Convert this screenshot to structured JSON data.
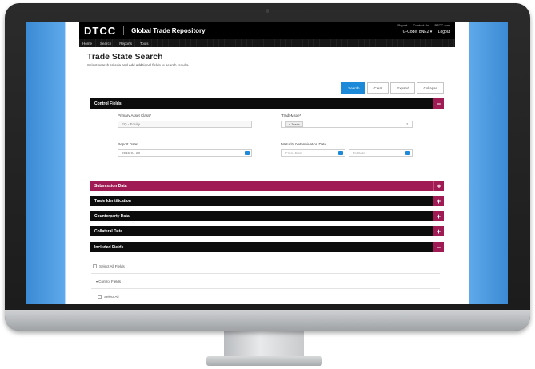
{
  "app": {
    "logo": "DTCC",
    "title": "Global Trade Repository",
    "top_links": [
      "Report",
      "Contact Us",
      "BTCC.com"
    ],
    "user_code": "G-Code: 8NE2 ▾",
    "logout": "Logout"
  },
  "nav": [
    "Home",
    "Search",
    "Reports",
    "Tools"
  ],
  "page": {
    "title": "Trade State Search",
    "subtitle": "Select search criteria and add additional fields to search results."
  },
  "buttons": {
    "search": "Search",
    "clear": "Clear",
    "expand": "Expand",
    "collapse": "Collapse"
  },
  "control_fields": {
    "header": "Control Fields",
    "toggle": "−",
    "primary_asset_label": "Primary Asset Class*",
    "primary_asset_value": "EQ - Equity",
    "trade_msg_label": "TradeMsge*",
    "trade_msg_value": "× Trade",
    "report_date_label": "Report Date*",
    "report_date_value": "2015-04-28",
    "maturity_label": "Maturity Determination Date",
    "maturity_from_placeholder": "From Date",
    "maturity_to_placeholder": "To Date"
  },
  "sections": [
    {
      "label": "Submission Data",
      "toggle": "+"
    },
    {
      "label": "Trade Identification",
      "toggle": "+"
    },
    {
      "label": "Counterparty Data",
      "toggle": "+"
    },
    {
      "label": "Collateral Data",
      "toggle": "+"
    },
    {
      "label": "Included Fields",
      "toggle": "−"
    }
  ],
  "included": {
    "select_all_fields": "Select All Fields",
    "control_fields": "Control Fields",
    "select_all": "Select All"
  },
  "colors": {
    "accent": "#1c8ad8",
    "brand": "#a01b53",
    "header": "#0c0c0c"
  }
}
